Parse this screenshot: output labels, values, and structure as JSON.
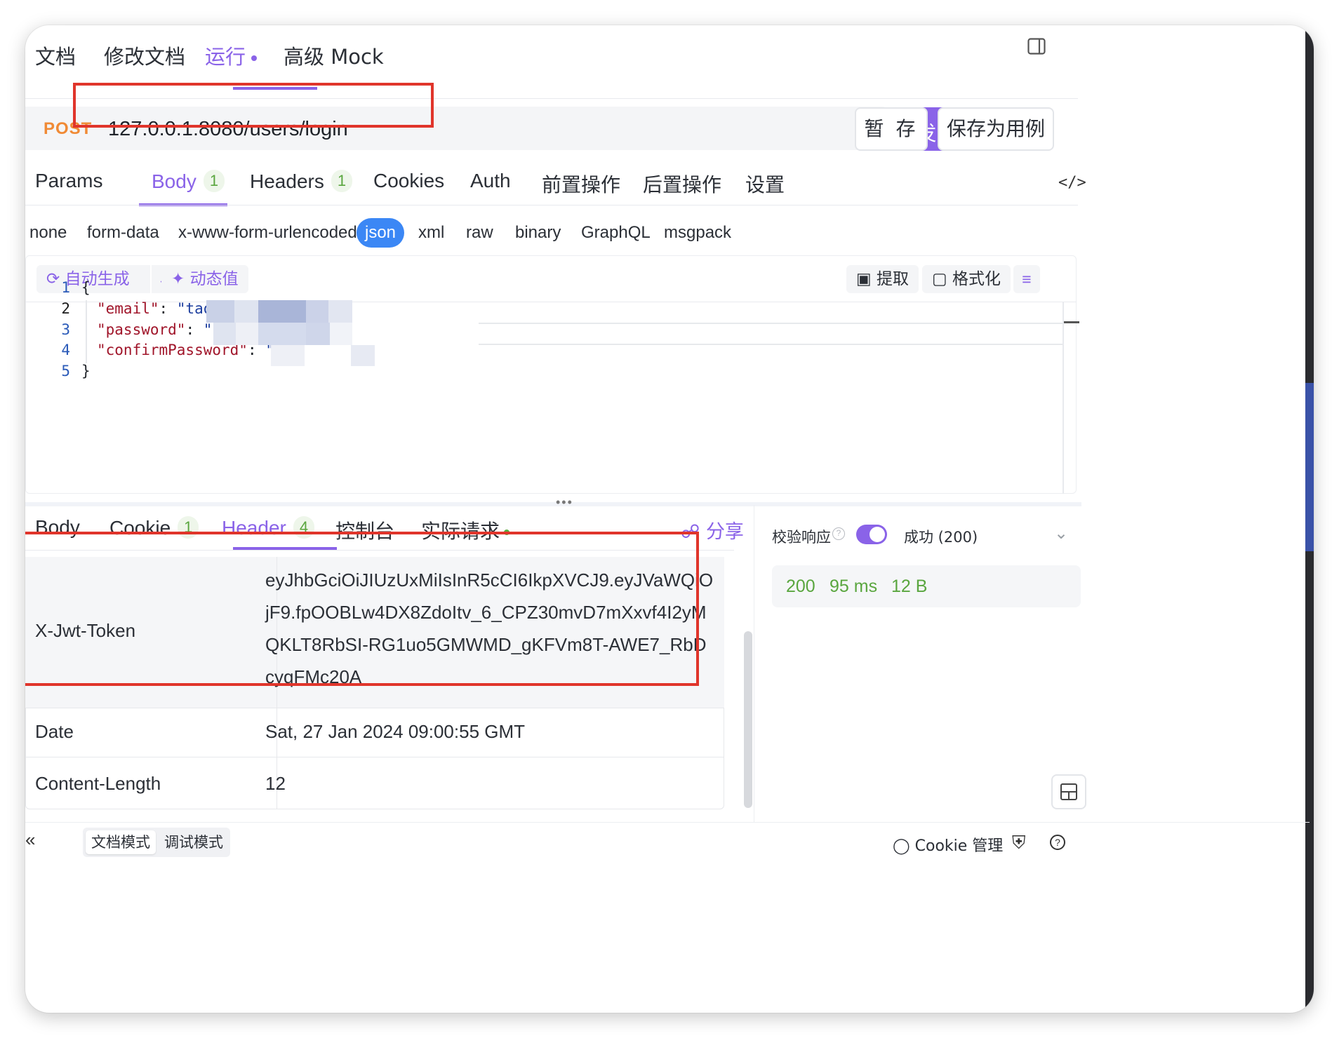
{
  "top_tabs": [
    "文档",
    "修改文档",
    "运行",
    "高级 Mock"
  ],
  "request": {
    "method": "POST",
    "url": "127.0.0.1:8080/users/login",
    "send_label": "发 送",
    "save_temp_label": "暂 存",
    "save_case_label": "保存为用例"
  },
  "request_tabs": [
    {
      "label": "Params"
    },
    {
      "label": "Body",
      "count": "1"
    },
    {
      "label": "Headers",
      "count": "1"
    },
    {
      "label": "Cookies"
    },
    {
      "label": "Auth"
    },
    {
      "label": "前置操作"
    },
    {
      "label": "后置操作"
    },
    {
      "label": "设置"
    }
  ],
  "body_types": [
    "none",
    "form-data",
    "x-www-form-urlencoded",
    "json",
    "xml",
    "raw",
    "binary",
    "GraphQL",
    "msgpack"
  ],
  "editor_tools": {
    "auto_generate": "自动生成",
    "dynamic_value": "动态值",
    "extract": "提取",
    "format": "格式化"
  },
  "code": {
    "line_numbers": [
      "1",
      "2",
      "3",
      "4",
      "5"
    ],
    "open_brace": "{",
    "close_brace": "}",
    "lines": [
      {
        "key": "\"email\"",
        "sep": ": ",
        "value": "\"tao"
      },
      {
        "key": "\"password\"",
        "sep": ": ",
        "value": "\""
      },
      {
        "key": "\"confirmPassword\"",
        "sep": ": ",
        "value": "\"S"
      }
    ]
  },
  "response_tabs": [
    {
      "label": "Body"
    },
    {
      "label": "Cookie",
      "count": "1"
    },
    {
      "label": "Header",
      "count": "4"
    },
    {
      "label": "控制台"
    },
    {
      "label": "实际请求"
    }
  ],
  "share_label": "分享",
  "response_headers": [
    {
      "name": "X-Jwt-Token",
      "value": "eyJhbGciOiJIUzUxMiIsInR5cCI6IkpXVCJ9.eyJVaWQiOjF9.fpOOBLw4DX8ZdoItv_6_CPZ30mvD7mXxvf4I2yMQKLT8RbSI-RG1uo5GMWMD_gKFVm8T-AWE7_RbDcyqFMc20A"
    },
    {
      "name": "Date",
      "value": "Sat, 27 Jan 2024 09:00:55 GMT"
    },
    {
      "name": "Content-Length",
      "value": "12"
    }
  ],
  "validate": {
    "label": "校验响应",
    "result": "成功 (200)"
  },
  "status": {
    "code": "200",
    "time": "95 ms",
    "size": "12 B"
  },
  "footer": {
    "doc_mode": "文档模式",
    "debug_mode": "调试模式",
    "cookie_manage": "Cookie 管理"
  },
  "colors": {
    "accent": "#8a63e8",
    "method": "#f08a35",
    "success": "#5aa63f",
    "highlight_box": "#e0352b",
    "json_active": "#3b87f5"
  }
}
